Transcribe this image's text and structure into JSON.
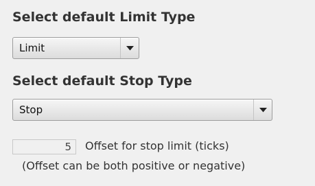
{
  "limit_type": {
    "heading": "Select default Limit Type",
    "selected": "Limit"
  },
  "stop_type": {
    "heading": "Select default Stop Type",
    "selected": "Stop"
  },
  "offset": {
    "value": "5",
    "label": "Offset for stop limit (ticks)",
    "note": "(Offset can be both positive or negative)"
  },
  "icons": {
    "dropdown_arrow": "chevron-down-icon"
  }
}
